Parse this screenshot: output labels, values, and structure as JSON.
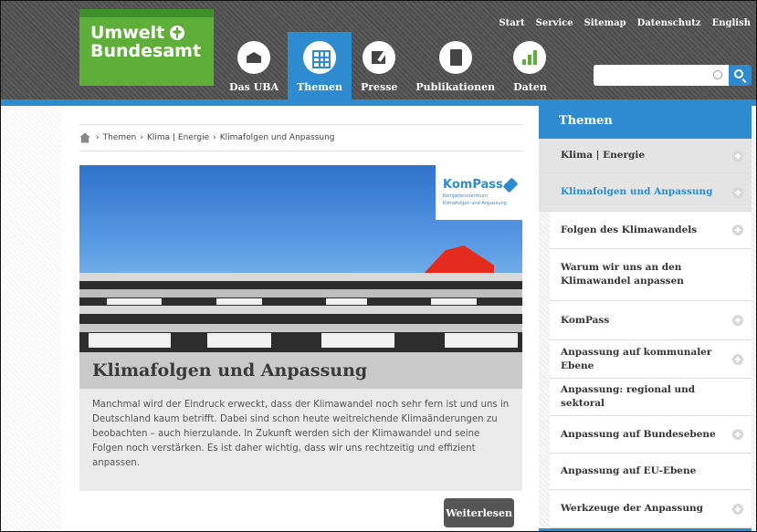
{
  "logo": {
    "line1": "Umwelt",
    "line2": "Bundesamt"
  },
  "nav": [
    {
      "label": "Das UBA",
      "icon": "house-icon",
      "active": false
    },
    {
      "label": "Themen",
      "icon": "grid-icon",
      "active": true
    },
    {
      "label": "Presse",
      "icon": "press-icon",
      "active": false
    },
    {
      "label": "Publikationen",
      "icon": "book-icon",
      "active": false
    },
    {
      "label": "Daten",
      "icon": "chart-icon",
      "active": false
    }
  ],
  "topnav": [
    "Start",
    "Service",
    "Sitemap",
    "Datenschutz",
    "English"
  ],
  "search": {
    "placeholder": ""
  },
  "breadcrumb": [
    "Themen",
    "Klima | Energie",
    "Klimafolgen und Anpassung"
  ],
  "hero": {
    "badge_title": "KomPass",
    "badge_sub1": "Kompetenzzentrum",
    "badge_sub2": "Klimafolgen und Anpassung",
    "title": "Klimafolgen und Anpassung"
  },
  "teaser": {
    "text": "Manchmal wird der Eindruck erweckt, dass der Klimawandel noch sehr fern ist und uns in Deutschland kaum betrifft. Dabei sind schon heute weitreichende Klimaänderungen zu beobachten – auch hierzulande. In Zukunft werden sich der Klimawandel und seine Folgen noch verstärken. Es ist daher wichtig, dass wir uns rechtzeitig und effizient anpassen.",
    "more_label": "Weiterlesen"
  },
  "sidebar": {
    "title": "Themen",
    "items": [
      {
        "label": "Klima | Energie",
        "level": "l1",
        "plus": true
      },
      {
        "label": "Klimafolgen und Anpassung",
        "level": "l2",
        "plus": true
      },
      {
        "label": "Folgen des Klimawandels",
        "level": "l3",
        "plus": true
      },
      {
        "label": "Warum wir uns an den Klimawandel anpassen",
        "level": "l3",
        "plus": false
      },
      {
        "label": "KomPass",
        "level": "l3",
        "plus": true
      },
      {
        "label": "Anpassung auf kommunaler Ebene",
        "level": "l3",
        "plus": true
      },
      {
        "label": "Anpassung: regional und sektoral",
        "level": "l3",
        "plus": false
      },
      {
        "label": "Anpassung auf Bundesebene",
        "level": "l3",
        "plus": true
      },
      {
        "label": "Anpassung auf EU-Ebene",
        "level": "l3",
        "plus": false
      },
      {
        "label": "Werkzeuge der Anpassung",
        "level": "l3",
        "plus": true
      }
    ]
  },
  "colors": {
    "accent": "#2e8bd0",
    "brand_green": "#5fae3a",
    "header_gray": "#555555"
  }
}
